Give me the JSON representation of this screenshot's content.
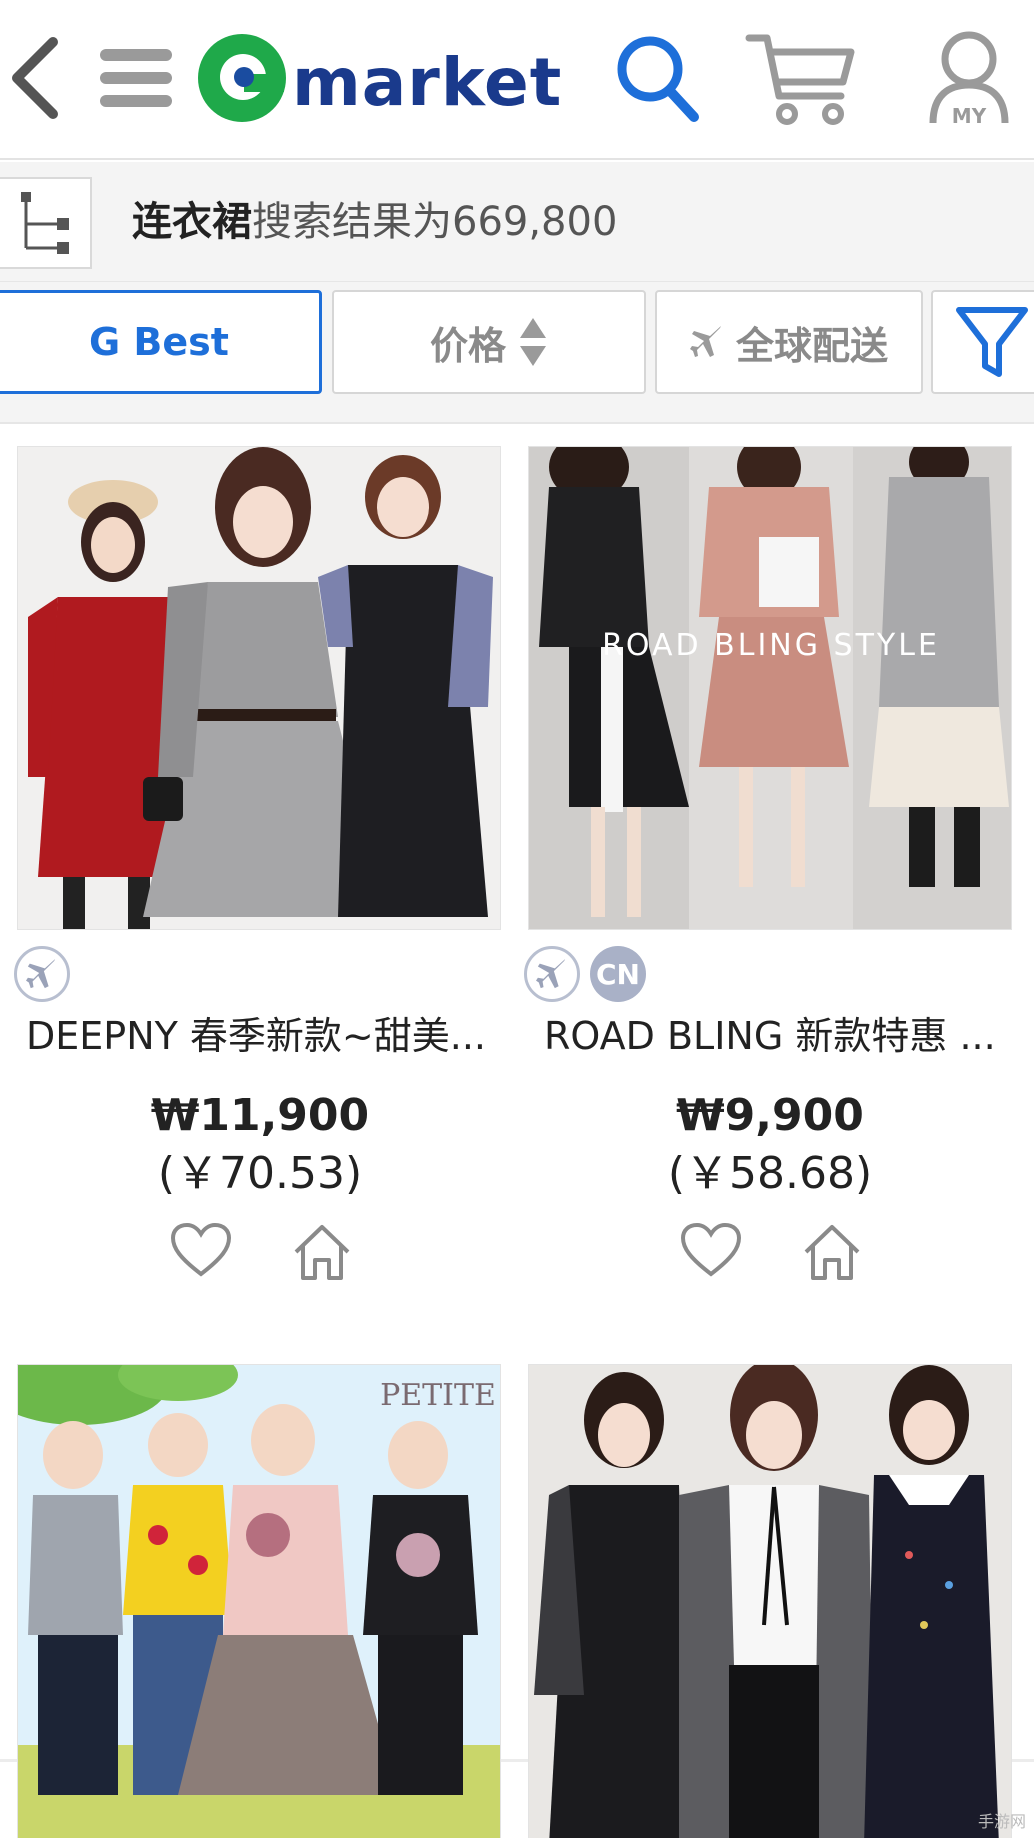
{
  "header": {
    "logo_text": "market",
    "icons": [
      "back-arrow-icon",
      "menu-icon",
      "search-icon",
      "cart-icon",
      "my-account-icon"
    ],
    "my_label": "MY",
    "colors": {
      "logo_green": "#1fa94a",
      "logo_blue": "#1a3a8c",
      "search_blue": "#1e6fd9",
      "icon_gray": "#9a9a9a"
    }
  },
  "result_bar": {
    "keyword": "连衣裙",
    "result_text": "搜索结果为669,800"
  },
  "filters": {
    "items": [
      {
        "label": "G Best",
        "active": true
      },
      {
        "label": "价格",
        "icon": "sort-updown-icon"
      },
      {
        "label": "全球配送",
        "icon": "airplane-icon"
      },
      {
        "label": "",
        "icon": "filter-funnel-icon"
      }
    ]
  },
  "products": [
    {
      "title": "DEEPNY 春季新款~甜美...",
      "price": "₩11,900",
      "price_cny": "(￥70.53)",
      "badges": [
        "airplane-icon"
      ]
    },
    {
      "title": "ROAD BLING 新款特惠 ...",
      "price": "₩9,900",
      "price_cny": "(￥58.68)",
      "badges": [
        "airplane-icon",
        "CN"
      ],
      "image_caption": "ROAD BLING STYLE"
    },
    {
      "title": "",
      "image_caption": "PETITE"
    },
    {
      "title": ""
    }
  ],
  "watermark": "手游网"
}
